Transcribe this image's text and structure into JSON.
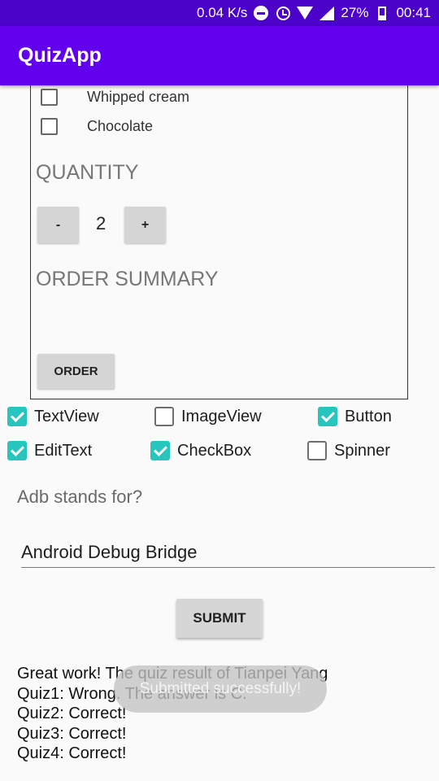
{
  "status_bar": {
    "speed": "0.04 K/s",
    "battery": "27%",
    "time": "00:41"
  },
  "app_bar": {
    "title": "QuizApp"
  },
  "preview": {
    "toppings": [
      "Whipped cream",
      "Chocolate"
    ],
    "quantity_heading": "QUANTITY",
    "decrement_label": "-",
    "quantity_value": "2",
    "increment_label": "+",
    "summary_heading": "ORDER SUMMARY",
    "order_label": "ORDER"
  },
  "checkboxes": [
    {
      "label": "TextView",
      "checked": true
    },
    {
      "label": "ImageView",
      "checked": false
    },
    {
      "label": "Button",
      "checked": true
    },
    {
      "label": "EditText",
      "checked": true
    },
    {
      "label": "CheckBox",
      "checked": true
    },
    {
      "label": "Spinner",
      "checked": false
    }
  ],
  "question": {
    "text": "Adb stands for?"
  },
  "answer": {
    "value": "Android Debug Bridge"
  },
  "submit": {
    "label": "SUBMIT"
  },
  "results": [
    "Great work! The quiz result of Tianpei Yang",
    "Quiz1: Wrong. The answer is C.",
    "Quiz2: Correct!",
    "Quiz3: Correct!",
    "Quiz4: Correct!"
  ],
  "toast": {
    "text": "Submitted successfully!"
  }
}
